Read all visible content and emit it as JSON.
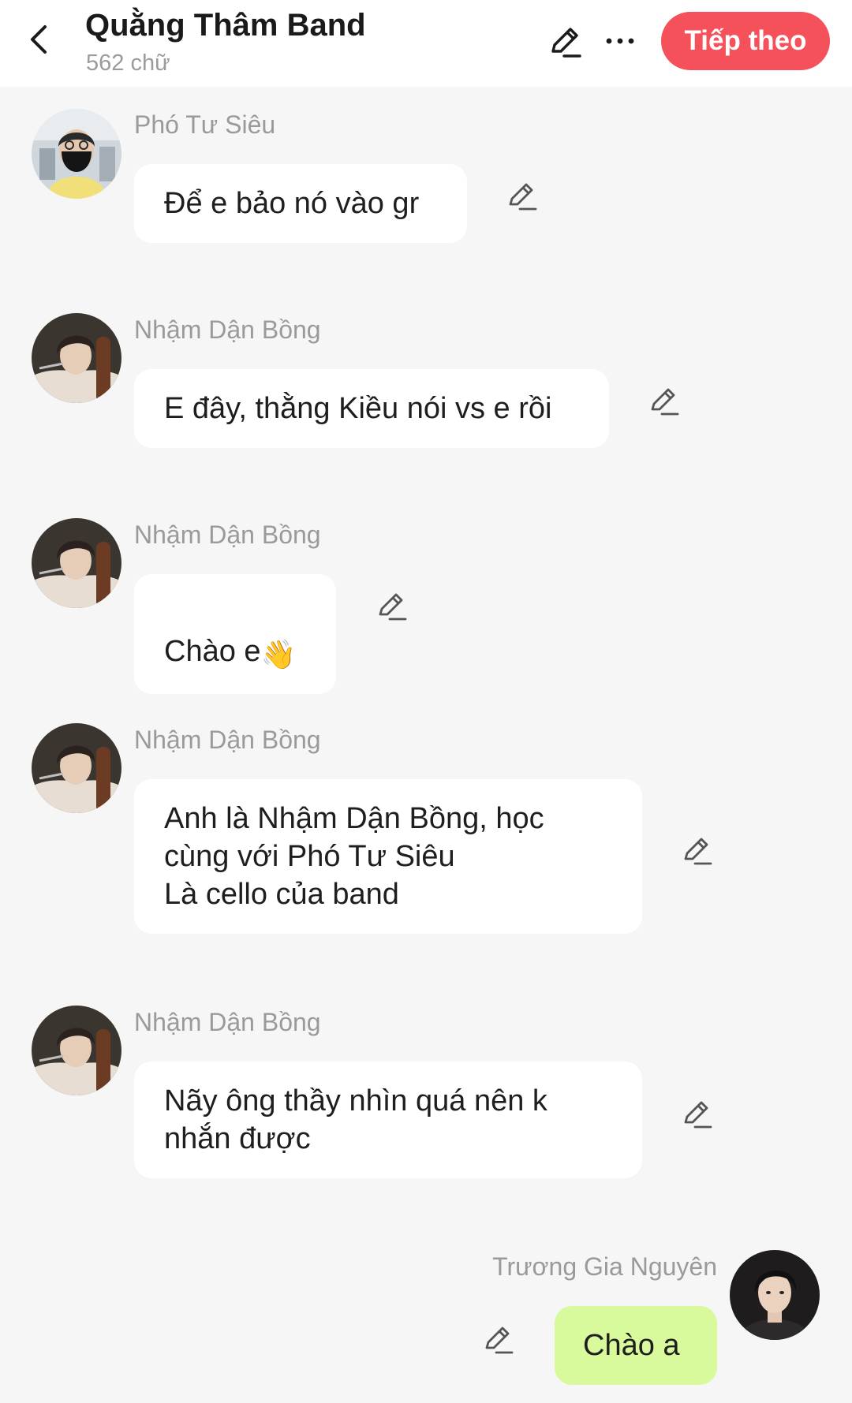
{
  "header": {
    "title": "Quằng Thâm Band",
    "subtitle": "562 chữ",
    "next_label": "Tiếp theo",
    "accent_color": "#f4515a"
  },
  "messages": [
    {
      "sender": "Phó Tư Siêu",
      "text": "Để e bảo nó vào gr",
      "avatar": "masked-person-avatar"
    },
    {
      "sender": "Nhậm Dận Bồng",
      "text": "E đây, thằng Kiều nói vs e rồi",
      "avatar": "cellist-avatar"
    },
    {
      "sender": "Nhậm Dận Bồng",
      "text": "Chào e",
      "emoji": "👋",
      "avatar": "cellist-avatar"
    },
    {
      "sender": "Nhậm Dận Bồng",
      "text": "Anh là Nhậm Dận Bồng, học\ncùng với Phó Tư Siêu\nLà cello của band",
      "avatar": "cellist-avatar"
    },
    {
      "sender": "Nhậm Dận Bồng",
      "text": "Nãy ông thầy nhìn quá nên k\nnhắn được",
      "avatar": "cellist-avatar"
    },
    {
      "sender": "Trương Gia Nguyên",
      "text": "Chào a",
      "avatar": "young-man-avatar",
      "mine": true
    }
  ],
  "icons": {
    "back": "chevron-left-icon",
    "edit": "pencil-icon",
    "more": "more-dots-icon"
  },
  "colors": {
    "background": "#f6f6f6",
    "bubble": "#ffffff",
    "my_bubble": "#d9f99d"
  }
}
